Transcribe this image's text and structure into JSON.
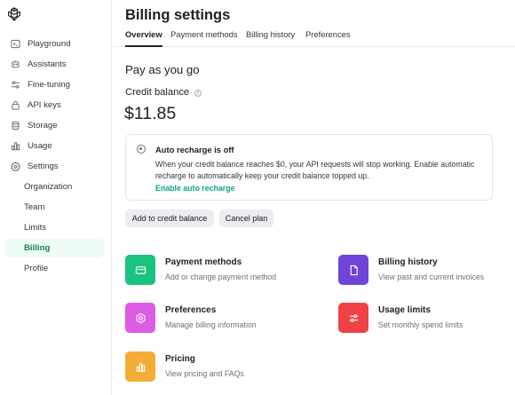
{
  "sidebar": {
    "items": [
      {
        "label": "Playground",
        "icon": "terminal-icon"
      },
      {
        "label": "Assistants",
        "icon": "robot-icon"
      },
      {
        "label": "Fine-tuning",
        "icon": "sliders-icon"
      },
      {
        "label": "API keys",
        "icon": "lock-icon"
      },
      {
        "label": "Storage",
        "icon": "database-icon"
      },
      {
        "label": "Usage",
        "icon": "bar-chart-icon"
      },
      {
        "label": "Settings",
        "icon": "gear-icon"
      }
    ],
    "settings_sub": [
      {
        "label": "Organization"
      },
      {
        "label": "Team"
      },
      {
        "label": "Limits"
      },
      {
        "label": "Billing",
        "active": true
      },
      {
        "label": "Profile"
      }
    ]
  },
  "page": {
    "title": "Billing settings",
    "tabs": [
      "Overview",
      "Payment methods",
      "Billing history",
      "Preferences"
    ],
    "active_tab": "Overview"
  },
  "plan": {
    "section_title": "Pay as you go",
    "credit_label": "Credit balance",
    "balance": "$11.85"
  },
  "auto_recharge": {
    "title": "Auto recharge is off",
    "description": "When your credit balance reaches $0, your API requests will stop working. Enable automatic recharge to automatically keep your credit balance topped up.",
    "link": "Enable auto recharge"
  },
  "buttons": {
    "add_credit": "Add to credit balance",
    "cancel_plan": "Cancel plan"
  },
  "cards": [
    {
      "title": "Payment methods",
      "desc": "Add or change payment method",
      "color": "#19c37d",
      "icon": "credit-card-icon"
    },
    {
      "title": "Billing history",
      "desc": "View past and current invoices",
      "color": "#6e44d9",
      "icon": "document-icon"
    },
    {
      "title": "Preferences",
      "desc": "Manage billing information",
      "color": "#dd5ce5",
      "icon": "gear-icon"
    },
    {
      "title": "Usage limits",
      "desc": "Set monthly spend limits",
      "color": "#ef4146",
      "icon": "sliders-icon"
    },
    {
      "title": "Pricing",
      "desc": "View pricing and FAQs",
      "color": "#f4ac36",
      "icon": "bar-chart-icon"
    }
  ],
  "colors": {
    "accent_green": "#10a37f",
    "active_bg": "#ecfbf3",
    "border": "#ececf1"
  }
}
